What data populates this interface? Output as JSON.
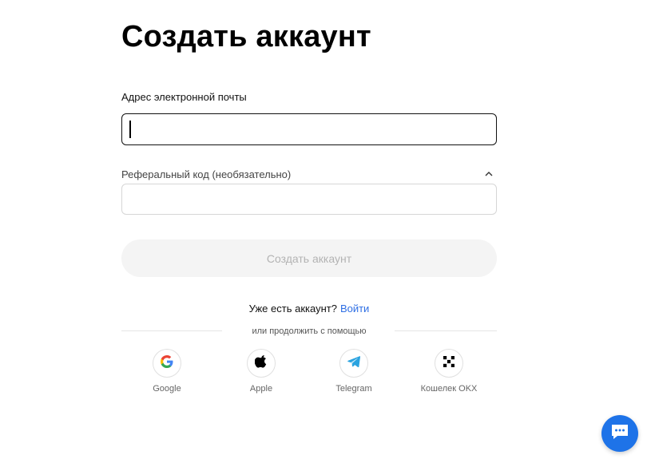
{
  "page": {
    "title": "Создать аккаунт"
  },
  "form": {
    "email_label": "Адрес электронной почты",
    "email_value": "",
    "referral_label": "Реферальный код (необязательно)",
    "referral_value": "",
    "submit_label": "Создать аккаунт"
  },
  "login": {
    "prompt": "Уже есть аккаунт?",
    "link_label": "Войти",
    "link_color": "#2f6fe4"
  },
  "divider": {
    "text": "или продолжить с помощью"
  },
  "social": [
    {
      "label": "Google",
      "icon": "google-icon"
    },
    {
      "label": "Apple",
      "icon": "apple-icon"
    },
    {
      "label": "Telegram",
      "icon": "telegram-icon"
    },
    {
      "label": "Кошелек OKX",
      "icon": "okx-icon"
    }
  ],
  "chat": {
    "icon": "chat-icon",
    "color": "#1e73e8"
  }
}
